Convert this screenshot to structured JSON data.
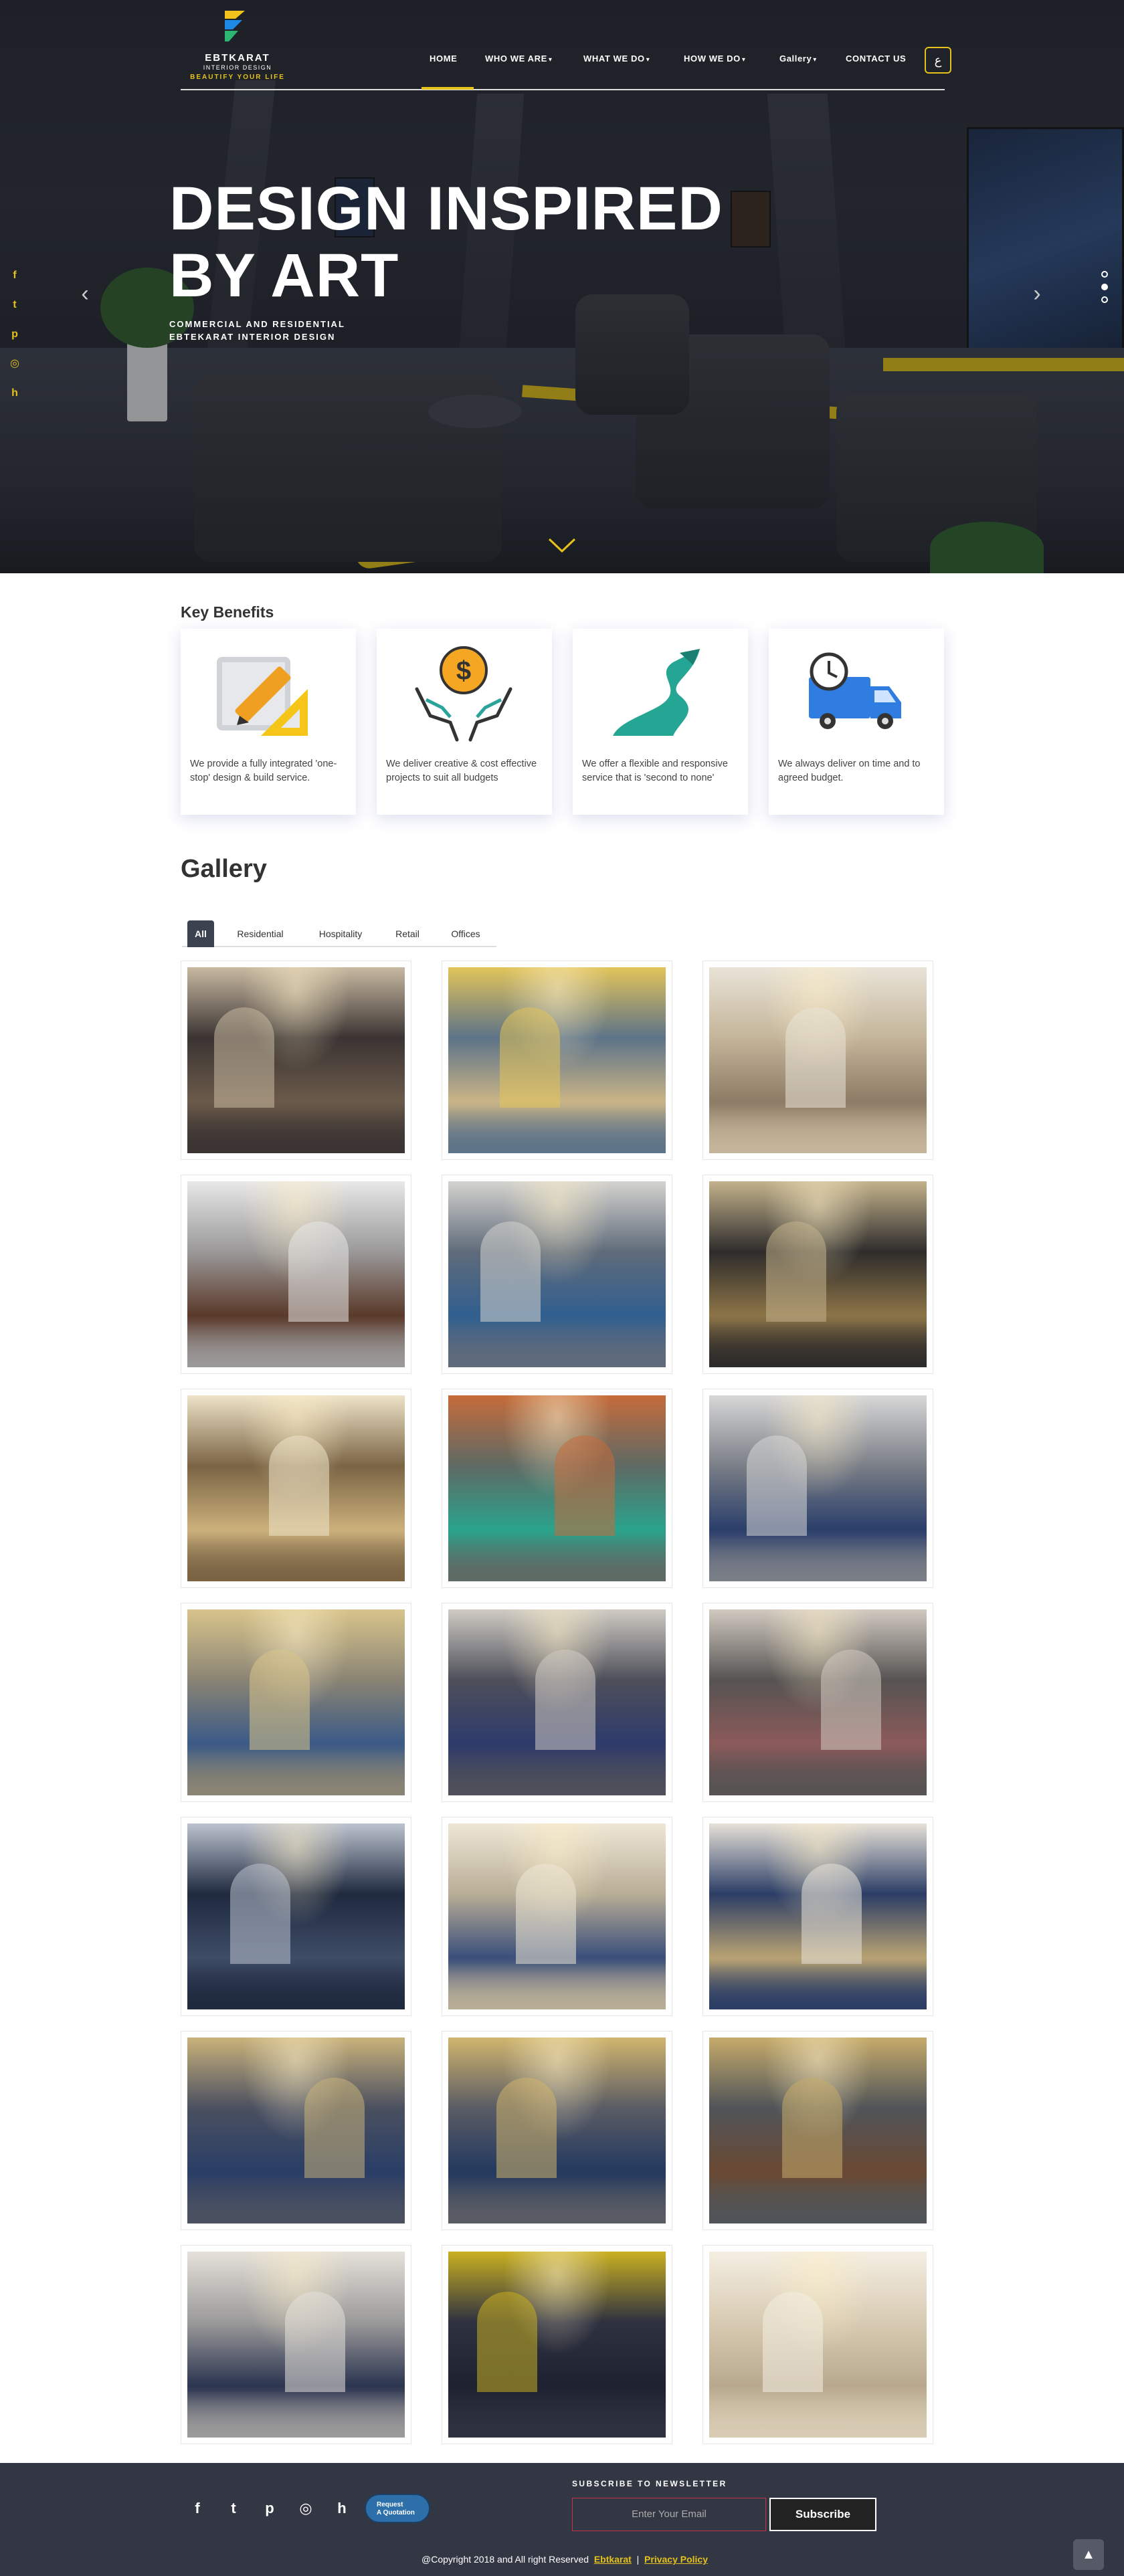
{
  "brand": {
    "name": "EBTKARAT",
    "tagline1": "INTERIOR DESIGN",
    "tagline2": "BEAUTIFY YOUR LIFE",
    "accent": "#e4c21b",
    "dark": "#333744"
  },
  "nav": {
    "items": [
      {
        "label": "HOME",
        "active": true
      },
      {
        "label": "WHO WE ARE",
        "dropdown": true
      },
      {
        "label": "WHAT WE DO",
        "dropdown": true
      },
      {
        "label": "HOW WE DO",
        "dropdown": true
      },
      {
        "label": "Gallery",
        "dropdown": true
      },
      {
        "label": "CONTACT US"
      }
    ],
    "dropdown_glyph": "▾",
    "lang_label": "ع"
  },
  "hero": {
    "title_line1": "DESIGN INSPIRED",
    "title_line2": "BY ART",
    "sub1": "COMMERCIAL AND RESIDENTIAL",
    "sub2": "EBTEKARAT INTERIOR DESIGN",
    "prev_glyph": "‹",
    "next_glyph": "›",
    "slide_count": 3,
    "active_slide": 2
  },
  "social_side": [
    "facebook-icon",
    "twitter-icon",
    "pinterest-icon",
    "instagram-icon",
    "houzz-icon"
  ],
  "social_glyphs": {
    "facebook": "f",
    "twitter": "t",
    "pinterest": "p",
    "instagram": "◎",
    "houzz": "h"
  },
  "benefits": {
    "title": "Key Benefits",
    "cards": [
      {
        "icon": "design-tools-icon",
        "text": "We provide a fully integrated 'one-stop' design & build service."
      },
      {
        "icon": "budget-hands-icon",
        "text": "We deliver creative & cost effective projects to suit all budgets"
      },
      {
        "icon": "flexible-road-icon",
        "text": "We offer a flexible and responsive service that is 'second to none'"
      },
      {
        "icon": "delivery-truck-icon",
        "text": "We always deliver on time and to agreed budget."
      }
    ]
  },
  "gallery": {
    "title": "Gallery",
    "tabs": [
      "All",
      "Residential",
      "Hospitality",
      "Retail",
      "Offices"
    ],
    "active_tab": "All",
    "images": [
      {
        "name": "majlis-teal-room",
        "c1": "#3b3433",
        "c2": "#6b5a4a",
        "c3": "#c8b9a1"
      },
      {
        "name": "arched-seating-room",
        "c1": "#5d7388",
        "c2": "#c9b487",
        "c3": "#e2c45a"
      },
      {
        "name": "cream-bedroom",
        "c1": "#c4b59a",
        "c2": "#8e7c66",
        "c3": "#e9e3d7"
      },
      {
        "name": "marble-bathroom",
        "c1": "#9a9898",
        "c2": "#5a3a2a",
        "c3": "#e8e8e8"
      },
      {
        "name": "blue-bathroom",
        "c1": "#5f6b7a",
        "c2": "#315f8f",
        "c3": "#d4d3cf"
      },
      {
        "name": "gold-mosaic-washroom",
        "c1": "#2e2c2b",
        "c2": "#8c7447",
        "c3": "#c3b28c"
      },
      {
        "name": "golden-vanity",
        "c1": "#7a6444",
        "c2": "#cbb07b",
        "c3": "#eee3c8"
      },
      {
        "name": "kids-room",
        "c1": "#5e6a64",
        "c2": "#2aa38c",
        "c3": "#c66b3a"
      },
      {
        "name": "blue-curtain-hall",
        "c1": "#7a7e86",
        "c2": "#2b3f6b",
        "c3": "#d7d7d7"
      },
      {
        "name": "grand-arch-hall",
        "c1": "#8a8474",
        "c2": "#3b5a86",
        "c3": "#d8c48b"
      },
      {
        "name": "dining-room-blue",
        "c1": "#4e4f5a",
        "c2": "#2e3b6b",
        "c3": "#cfcbc4"
      },
      {
        "name": "dining-room-plates",
        "c1": "#565352",
        "c2": "#8b5a5a",
        "c3": "#d1cac1"
      },
      {
        "name": "navy-kitchen",
        "c1": "#1f2a3f",
        "c2": "#3e4c66",
        "c3": "#bcc3cf"
      },
      {
        "name": "cream-living-room",
        "c1": "#b8ad96",
        "c2": "#3a4f7a",
        "c3": "#efe7d6"
      },
      {
        "name": "arched-blue-lounge",
        "c1": "#2c3e66",
        "c2": "#b8a273",
        "c3": "#e6e1d8"
      },
      {
        "name": "master-bedroom-1",
        "c1": "#4a5060",
        "c2": "#2a3e66",
        "c3": "#c9b27a"
      },
      {
        "name": "master-bedroom-2",
        "c1": "#5a5c64",
        "c2": "#23395e",
        "c3": "#d0b56e"
      },
      {
        "name": "master-bedroom-3",
        "c1": "#505458",
        "c2": "#6a4a34",
        "c3": "#c6ab6a"
      },
      {
        "name": "grey-living-room",
        "c1": "#9b9a9a",
        "c2": "#2c3550",
        "c3": "#e5e1da"
      },
      {
        "name": "home-cinema",
        "c1": "#2e3140",
        "c2": "#1e2230",
        "c3": "#c9b021"
      },
      {
        "name": "study-corner",
        "c1": "#d8cbb3",
        "c2": "#b8a98e",
        "c3": "#f4eee2"
      }
    ]
  },
  "footer": {
    "social": [
      "facebook-icon",
      "twitter-icon",
      "pinterest-icon",
      "instagram-icon",
      "houzz-icon"
    ],
    "quote_line1": "Request",
    "quote_line2": "A Quotation",
    "subscribe_title": "SUBSCRIBE TO NEWSLETTER",
    "email_placeholder": "Enter Your Email",
    "subscribe_button": "Subscribe",
    "copyright": "@Copyright 2018 and All right Reserved",
    "company_link": "Ebtkarat",
    "separator": "|",
    "privacy_link": "Privacy Policy",
    "to_top_glyph": "▲"
  }
}
